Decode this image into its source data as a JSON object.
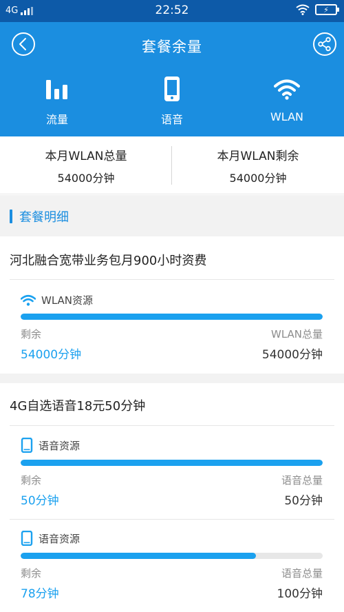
{
  "status": {
    "network": "4G",
    "time": "22:52"
  },
  "header": {
    "title": "套餐余量",
    "tabs": [
      {
        "label": "流量",
        "icon": "bar-chart-icon"
      },
      {
        "label": "语音",
        "icon": "phone-icon"
      },
      {
        "label": "WLAN",
        "icon": "wifi-icon"
      }
    ]
  },
  "summary": {
    "total_label": "本月WLAN总量",
    "total_value": "54000分钟",
    "remain_label": "本月WLAN剩余",
    "remain_value": "54000分钟"
  },
  "section": {
    "title": "套餐明细"
  },
  "packages": [
    {
      "name": "河北融合宽带业务包月900小时资费",
      "resources": [
        {
          "icon": "wifi-icon",
          "type_label": "WLAN资源",
          "left_label": "剩余",
          "left_value": "54000分钟",
          "right_label": "WLAN总量",
          "right_value": "54000分钟",
          "fraction": 1.0
        }
      ]
    },
    {
      "name": "4G自选语音18元50分钟",
      "resources": [
        {
          "icon": "phone-icon",
          "type_label": "语音资源",
          "left_label": "剩余",
          "left_value": "50分钟",
          "right_label": "语音总量",
          "right_value": "50分钟",
          "fraction": 1.0
        },
        {
          "icon": "phone-icon",
          "type_label": "语音资源",
          "left_label": "剩余",
          "left_value": "78分钟",
          "right_label": "语音总量",
          "right_value": "100分钟",
          "fraction": 0.78
        }
      ]
    }
  ],
  "colors": {
    "status_bar": "#0d5aa8",
    "header": "#1b8ee0",
    "accent": "#1ba1ef"
  }
}
